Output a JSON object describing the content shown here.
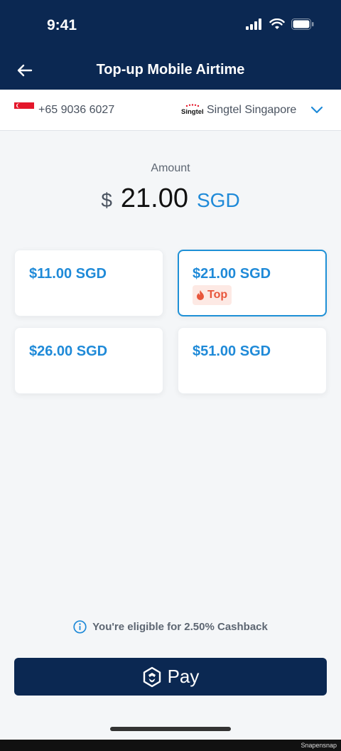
{
  "status": {
    "time": "9:41"
  },
  "header": {
    "title": "Top-up Mobile Airtime"
  },
  "carrier": {
    "phone": "+65 9036 6027",
    "name": "Singtel Singapore",
    "logo_text": "Singtel"
  },
  "amount": {
    "label": "Amount",
    "symbol": "$",
    "value": "21.00",
    "currency": "SGD"
  },
  "options": [
    {
      "label": "$11.00 SGD",
      "selected": false
    },
    {
      "label": "$21.00 SGD",
      "selected": true,
      "badge": "Top"
    },
    {
      "label": "$26.00 SGD",
      "selected": false
    },
    {
      "label": "$51.00 SGD",
      "selected": false
    }
  ],
  "cashback": {
    "text": "You're eligible for 2.50% Cashback"
  },
  "pay_button": {
    "label": "Pay"
  },
  "watermark": "Snapensnap",
  "colors": {
    "navy": "#0b2852",
    "accent": "#1f8ad8",
    "badge": "#e8563b"
  }
}
